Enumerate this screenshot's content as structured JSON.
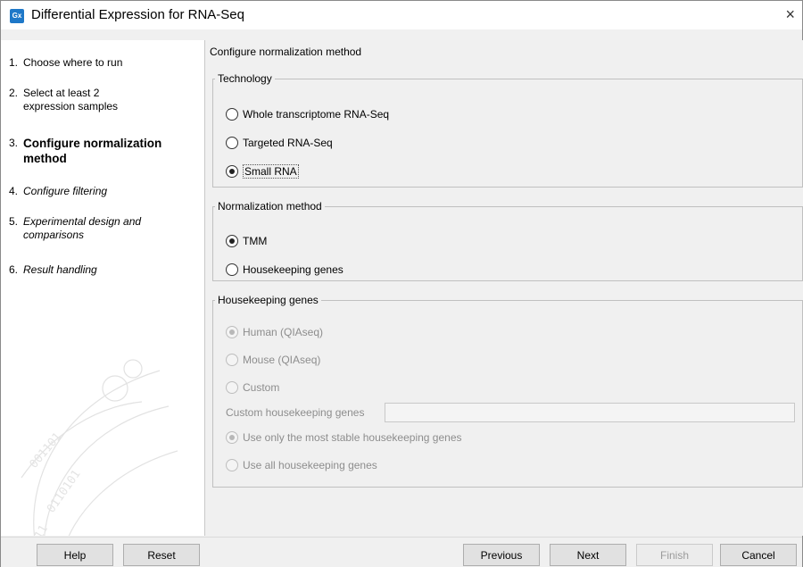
{
  "window": {
    "title": "Differential Expression for RNA-Seq",
    "app_icon_text": "Gx",
    "close_glyph": "×"
  },
  "sidebar": {
    "steps": [
      {
        "num": "1.",
        "label": "Choose where to run",
        "state": "done"
      },
      {
        "num": "2.",
        "label": "Select at least 2 expression samples",
        "state": "done"
      },
      {
        "num": "3.",
        "label": "Configure normalization method",
        "state": "active"
      },
      {
        "num": "4.",
        "label": "Configure filtering",
        "state": "future"
      },
      {
        "num": "5.",
        "label": "Experimental design and comparisons",
        "state": "future"
      },
      {
        "num": "6.",
        "label": "Result handling",
        "state": "future"
      }
    ]
  },
  "main": {
    "page_title": "Configure normalization method",
    "technology": {
      "legend": "Technology",
      "options": [
        {
          "label": "Whole transcriptome RNA-Seq",
          "checked": false
        },
        {
          "label": "Targeted RNA-Seq",
          "checked": false
        },
        {
          "label": "Small RNA",
          "checked": true
        }
      ]
    },
    "normalization": {
      "legend": "Normalization method",
      "options": [
        {
          "label": "TMM",
          "checked": true
        },
        {
          "label": "Housekeeping genes",
          "checked": false
        }
      ]
    },
    "housekeeping": {
      "legend": "Housekeeping genes",
      "options": [
        {
          "label": "Human (QIAseq)",
          "checked": true
        },
        {
          "label": "Mouse (QIAseq)",
          "checked": false
        },
        {
          "label": "Custom",
          "checked": false
        }
      ],
      "custom_label": "Custom housekeeping genes",
      "custom_value": "",
      "stability_options": [
        {
          "label": "Use only the most stable housekeeping genes",
          "checked": true
        },
        {
          "label": "Use all housekeeping genes",
          "checked": false
        }
      ]
    }
  },
  "buttons": {
    "help": "Help",
    "reset": "Reset",
    "previous": "Previous",
    "next": "Next",
    "finish": "Finish",
    "cancel": "Cancel"
  },
  "colors": {
    "accent": "#1e78c8",
    "disabled_text": "#8d8d8d"
  }
}
